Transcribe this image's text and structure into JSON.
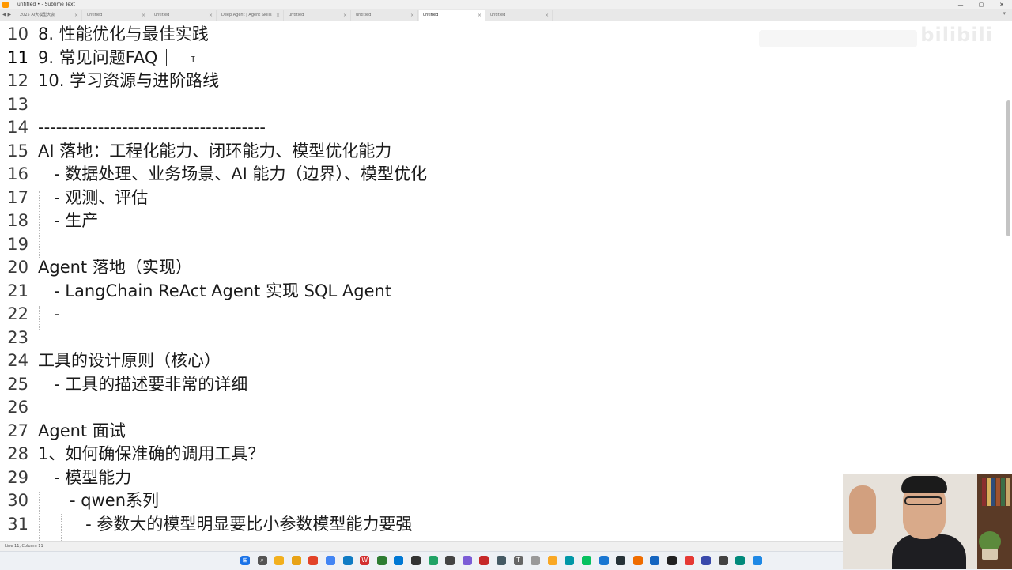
{
  "window": {
    "title": "untitled • - Sublime Text",
    "controls": [
      "—",
      "▢",
      "✕"
    ]
  },
  "tabs": [
    {
      "label": "2025 AI大模型大会",
      "active": false
    },
    {
      "label": "untitled",
      "active": false
    },
    {
      "label": "untitled",
      "active": false
    },
    {
      "label": "Deep Agent | Agent Skills",
      "active": false
    },
    {
      "label": "untitled",
      "active": false
    },
    {
      "label": "untitled",
      "active": false
    },
    {
      "label": "untitled",
      "active": true
    },
    {
      "label": "untitled",
      "active": false
    }
  ],
  "editor": {
    "current_line": 11,
    "lines": [
      {
        "n": "10",
        "text": "8. 性能优化与最佳实践"
      },
      {
        "n": "11",
        "text": "9. 常见问题FAQ"
      },
      {
        "n": "12",
        "text": "10. 学习资源与进阶路线"
      },
      {
        "n": "13",
        "text": ""
      },
      {
        "n": "14",
        "text": "--------------------------------------"
      },
      {
        "n": "15",
        "text": "AI 落地：工程化能力、闭环能力、模型优化能力"
      },
      {
        "n": "16",
        "text": "   - 数据处理、业务场景、AI 能力（边界）、模型优化"
      },
      {
        "n": "17",
        "text": "   - 观测、评估"
      },
      {
        "n": "18",
        "text": "   - 生产"
      },
      {
        "n": "19",
        "text": ""
      },
      {
        "n": "20",
        "text": "Agent 落地（实现）"
      },
      {
        "n": "21",
        "text": "   - LangChain ReAct Agent 实现 SQL Agent"
      },
      {
        "n": "22",
        "text": "   -"
      },
      {
        "n": "23",
        "text": ""
      },
      {
        "n": "24",
        "text": "工具的设计原则（核心）"
      },
      {
        "n": "25",
        "text": "   - 工具的描述要非常的详细"
      },
      {
        "n": "26",
        "text": ""
      },
      {
        "n": "27",
        "text": "Agent 面试"
      },
      {
        "n": "28",
        "text": "1、如何确保准确的调用工具？"
      },
      {
        "n": "29",
        "text": "   - 模型能力"
      },
      {
        "n": "30",
        "text": "      - qwen系列"
      },
      {
        "n": "31",
        "text": "         - 参数大的模型明显要比小参数模型能力要强"
      }
    ]
  },
  "watermark": {
    "text": "bilibili"
  },
  "status": {
    "text": "Line 11, Column 11"
  },
  "taskbar": {
    "icons": [
      {
        "name": "windows-start-icon",
        "color": "#1a73e8",
        "glyph": "⊞"
      },
      {
        "name": "search-icon",
        "color": "#555555",
        "glyph": "⌕"
      },
      {
        "name": "file-explorer-icon",
        "color": "#f2b01e",
        "glyph": ""
      },
      {
        "name": "folder-icon",
        "color": "#e8a317",
        "glyph": ""
      },
      {
        "name": "git-icon",
        "color": "#e24329",
        "glyph": ""
      },
      {
        "name": "chrome-icon",
        "color": "#4285f4",
        "glyph": ""
      },
      {
        "name": "edge-icon",
        "color": "#0f7bc4",
        "glyph": ""
      },
      {
        "name": "wps-icon",
        "color": "#d32f2f",
        "glyph": "W"
      },
      {
        "name": "app-icon",
        "color": "#2e7d32",
        "glyph": ""
      },
      {
        "name": "vscode-icon",
        "color": "#0078d4",
        "glyph": ""
      },
      {
        "name": "app-icon",
        "color": "#333333",
        "glyph": ""
      },
      {
        "name": "pycharm-icon",
        "color": "#21a366",
        "glyph": ""
      },
      {
        "name": "terminal-icon",
        "color": "#444444",
        "glyph": ""
      },
      {
        "name": "app-icon",
        "color": "#7b5cd6",
        "glyph": ""
      },
      {
        "name": "record-icon",
        "color": "#c62828",
        "glyph": ""
      },
      {
        "name": "app-icon",
        "color": "#455a64",
        "glyph": ""
      },
      {
        "name": "typora-icon",
        "color": "#666666",
        "glyph": "T"
      },
      {
        "name": "note-icon",
        "color": "#999999",
        "glyph": ""
      },
      {
        "name": "app-icon",
        "color": "#f9a825",
        "glyph": ""
      },
      {
        "name": "app-icon",
        "color": "#0097a7",
        "glyph": ""
      },
      {
        "name": "wechat-icon",
        "color": "#07c160",
        "glyph": ""
      },
      {
        "name": "app-icon",
        "color": "#1976d2",
        "glyph": ""
      },
      {
        "name": "app-icon",
        "color": "#263238",
        "glyph": ""
      },
      {
        "name": "app-icon",
        "color": "#ef6c00",
        "glyph": ""
      },
      {
        "name": "app-icon",
        "color": "#1565c0",
        "glyph": ""
      },
      {
        "name": "app-icon",
        "color": "#212121",
        "glyph": ""
      },
      {
        "name": "app-icon",
        "color": "#e53935",
        "glyph": ""
      },
      {
        "name": "app-icon",
        "color": "#3949ab",
        "glyph": ""
      },
      {
        "name": "app-icon",
        "color": "#424242",
        "glyph": ""
      },
      {
        "name": "app-icon",
        "color": "#00897b",
        "glyph": ""
      },
      {
        "name": "app-icon",
        "color": "#1e88e5",
        "glyph": ""
      }
    ]
  }
}
